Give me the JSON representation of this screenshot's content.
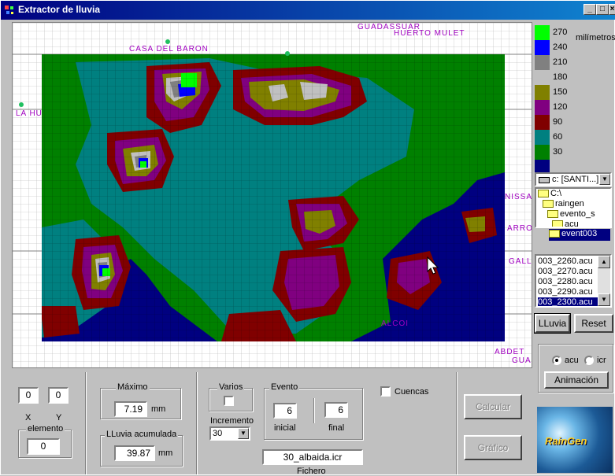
{
  "window": {
    "title": "Extractor de lluvia"
  },
  "titlebar_buttons": {
    "minimize": "_",
    "maximize": "□",
    "close": "×"
  },
  "map": {
    "towns": [
      "CASA DEL BARON",
      "GUADASSUAR",
      "HUERTO MULET",
      "LA HU",
      "NISSA",
      "ARRO",
      "GALL",
      "ALCOI",
      "ABDET",
      "GUA"
    ]
  },
  "legend": {
    "unit": "milímetros",
    "items": [
      {
        "label": "270",
        "color": "#00ff00"
      },
      {
        "label": "240",
        "color": "#0000ff"
      },
      {
        "label": "210",
        "color": "#808080"
      },
      {
        "label": "180",
        "color": "#c0c0c0"
      },
      {
        "label": "150",
        "color": "#808000"
      },
      {
        "label": "120",
        "color": "#800080"
      },
      {
        "label": "90",
        "color": "#800000"
      },
      {
        "label": "60",
        "color": "#008080"
      },
      {
        "label": "30",
        "color": "#008000"
      },
      {
        "label": "",
        "color": "#000080"
      }
    ]
  },
  "drive": {
    "value": "c: [SANTI...]"
  },
  "dirs": [
    "C:\\",
    "raingen",
    "evento_s",
    "acu",
    "event003"
  ],
  "files": [
    "003_2260.acu",
    "003_2270.acu",
    "003_2280.acu",
    "003_2290.acu",
    "003_2300.acu"
  ],
  "buttons": {
    "lluvia": "LLuvia",
    "reset": "Reset",
    "animacion": "Animación",
    "calcular": "Calcular",
    "grafico": "Gráfico"
  },
  "mode": {
    "acu": "acu",
    "icr": "icr"
  },
  "coords": {
    "x_value": "0",
    "y_value": "0",
    "x_label": "X",
    "y_label": "Y"
  },
  "elemento": {
    "label": "elemento",
    "value": "0"
  },
  "maximo": {
    "label": "Máximo",
    "value": "7.19",
    "unit": "mm"
  },
  "acumulada": {
    "label": "LLuvia acumulada",
    "value": "39.87",
    "unit": "mm"
  },
  "varios": {
    "label": "Varios"
  },
  "incremento": {
    "label": "Incremento",
    "value": "30"
  },
  "evento": {
    "label": "Evento",
    "inicial_value": "6",
    "final_value": "6",
    "inicial_label": "inicial",
    "final_label": "final"
  },
  "cuencas": {
    "label": "Cuencas"
  },
  "fichero": {
    "value": "30_albaida.icr",
    "label": "Fichero"
  },
  "logo": {
    "text": "RainGen"
  }
}
